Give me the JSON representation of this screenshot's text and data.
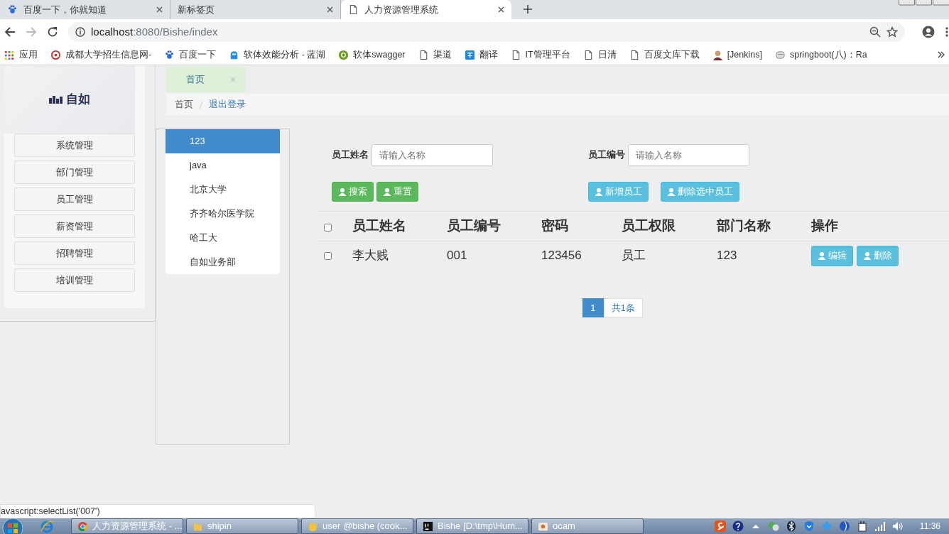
{
  "browser": {
    "tabs": [
      {
        "title": "百度一下，你就知道",
        "kind": "paw",
        "selected": false
      },
      {
        "title": "新标签页",
        "selected": false
      },
      {
        "title": "人力资源管理系统",
        "kind": "page",
        "selected": true
      }
    ],
    "url": {
      "host": "localhost",
      "path": ":8080/Bishe/index"
    },
    "bookmarks": [
      {
        "label": "应用",
        "kind": "apps"
      },
      {
        "label": "成都大学招生信息网-",
        "kind": "ring"
      },
      {
        "label": "百度一下",
        "kind": "paw"
      },
      {
        "label": "软体效能分析 - 蓝湖",
        "kind": "bird"
      },
      {
        "label": "软体swagger",
        "kind": "swagger"
      },
      {
        "label": "渠道",
        "kind": "page"
      },
      {
        "label": "翻译",
        "kind": "translate"
      },
      {
        "label": "IT管理平台",
        "kind": "page"
      },
      {
        "label": "日清",
        "kind": "page"
      },
      {
        "label": "百度文库下载",
        "kind": "page"
      },
      {
        "label": "[Jenkins]",
        "kind": "avatar"
      },
      {
        "label": "springboot(八)：Ra",
        "kind": "robot"
      }
    ]
  },
  "sidebar": {
    "logo": "自如",
    "menu": [
      "系统管理",
      "部门管理",
      "员工管理",
      "薪资管理",
      "招聘管理",
      "培训管理"
    ]
  },
  "page_tabs": [
    {
      "label": "首页",
      "selected": true
    }
  ],
  "breadcrumb": [
    {
      "label": "首页",
      "kind": "text"
    },
    {
      "label": "退出登录",
      "kind": "link"
    }
  ],
  "departments": [
    {
      "label": "123",
      "selected": true
    },
    {
      "label": "java",
      "selected": false
    },
    {
      "label": "北京大学",
      "selected": false
    },
    {
      "label": "齐齐哈尔医学院",
      "selected": false
    },
    {
      "label": "哈工大",
      "selected": false
    },
    {
      "label": "自如业务部",
      "selected": false
    }
  ],
  "filters": [
    {
      "label": "员工姓名",
      "placeholder": "请输入名称"
    },
    {
      "label": "员工编号",
      "placeholder": "请输入名称"
    }
  ],
  "button_groups": [
    [
      {
        "label": "搜索",
        "kind": "success"
      },
      {
        "label": "重置",
        "kind": "success"
      }
    ],
    [
      {
        "label": "新增员工",
        "kind": "info"
      },
      {
        "label": "删除选中员工",
        "kind": "info"
      }
    ]
  ],
  "table": {
    "columns": [
      "员工姓名",
      "员工编号",
      "密码",
      "员工权限",
      "部门名称",
      "操作"
    ],
    "header_checked": false,
    "rows": [
      {
        "checked": false,
        "cells": [
          "李大贱",
          "001",
          "123456",
          "员工",
          "123"
        ],
        "actions": [
          "编辑",
          "删除"
        ]
      }
    ]
  },
  "pagination": {
    "pages": [
      {
        "label": "1",
        "selected": true
      }
    ],
    "total": "共1条"
  },
  "status_url": "avascript:selectList('007')",
  "taskbar": {
    "windows": [
      {
        "label": "人力资源管理系统 - ...",
        "kind": "chrome"
      },
      {
        "label": "shipin",
        "kind": "folder"
      },
      {
        "label": "user @bishe (cook...",
        "kind": "cat"
      },
      {
        "label": "Bishe [D:\\tmp\\Hum...",
        "kind": "ij"
      },
      {
        "label": "ocam",
        "kind": "ocam"
      }
    ],
    "clock": "11:36"
  }
}
